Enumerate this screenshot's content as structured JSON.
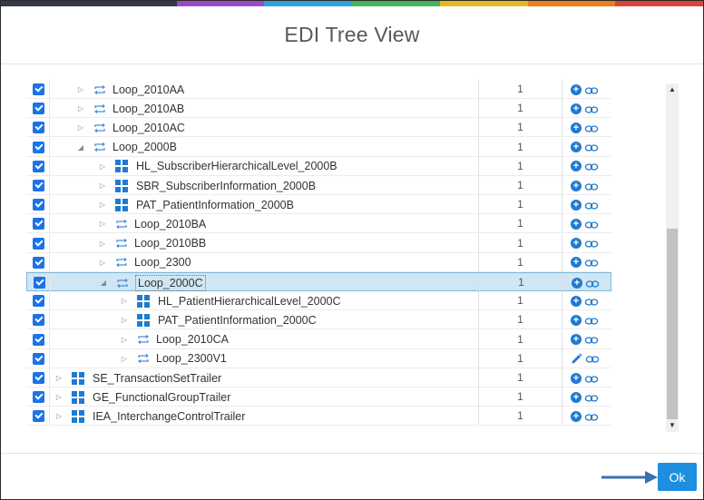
{
  "dialog": {
    "title": "EDI Tree View",
    "ok_label": "Ok",
    "stripe_colors": [
      "#33384d",
      "#33384d",
      "#9a4bc4",
      "#2ea2e5",
      "#43b55c",
      "#e8b71c",
      "#f07c1c",
      "#d9453a"
    ]
  },
  "rows": [
    {
      "name": "Loop_2010AA",
      "type": "loop",
      "level": 1,
      "expand": "collapsed",
      "count": "1",
      "action": "plus"
    },
    {
      "name": "Loop_2010AB",
      "type": "loop",
      "level": 1,
      "expand": "collapsed",
      "count": "1",
      "action": "plus"
    },
    {
      "name": "Loop_2010AC",
      "type": "loop",
      "level": 1,
      "expand": "collapsed",
      "count": "1",
      "action": "plus"
    },
    {
      "name": "Loop_2000B",
      "type": "loop",
      "level": 1,
      "expand": "expanded",
      "count": "1",
      "action": "plus"
    },
    {
      "name": "HL_SubscriberHierarchicalLevel_2000B",
      "type": "segment",
      "level": 2,
      "expand": "collapsed",
      "count": "1",
      "action": "plus"
    },
    {
      "name": "SBR_SubscriberInformation_2000B",
      "type": "segment",
      "level": 2,
      "expand": "collapsed",
      "count": "1",
      "action": "plus"
    },
    {
      "name": "PAT_PatientInformation_2000B",
      "type": "segment",
      "level": 2,
      "expand": "collapsed",
      "count": "1",
      "action": "plus"
    },
    {
      "name": "Loop_2010BA",
      "type": "loop",
      "level": 2,
      "expand": "collapsed",
      "count": "1",
      "action": "plus"
    },
    {
      "name": "Loop_2010BB",
      "type": "loop",
      "level": 2,
      "expand": "collapsed",
      "count": "1",
      "action": "plus"
    },
    {
      "name": "Loop_2300",
      "type": "loop",
      "level": 2,
      "expand": "collapsed",
      "count": "1",
      "action": "plus"
    },
    {
      "name": "Loop_2000C",
      "type": "loop",
      "level": 2,
      "expand": "expanded",
      "count": "1",
      "action": "plus",
      "selected": true
    },
    {
      "name": "HL_PatientHierarchicalLevel_2000C",
      "type": "segment",
      "level": 3,
      "expand": "collapsed",
      "count": "1",
      "action": "plus"
    },
    {
      "name": "PAT_PatientInformation_2000C",
      "type": "segment",
      "level": 3,
      "expand": "collapsed",
      "count": "1",
      "action": "plus"
    },
    {
      "name": "Loop_2010CA",
      "type": "loop",
      "level": 3,
      "expand": "collapsed",
      "count": "1",
      "action": "plus"
    },
    {
      "name": "Loop_2300V1",
      "type": "loop",
      "level": 3,
      "expand": "collapsed",
      "count": "1",
      "action": "pencil"
    },
    {
      "name": "SE_TransactionSetTrailer",
      "type": "segment",
      "level": 0,
      "expand": "collapsed",
      "count": "1",
      "action": "plus"
    },
    {
      "name": "GE_FunctionalGroupTrailer",
      "type": "segment",
      "level": 0,
      "expand": "collapsed",
      "count": "1",
      "action": "plus"
    },
    {
      "name": "IEA_InterchangeControlTrailer",
      "type": "segment",
      "level": 0,
      "expand": "collapsed",
      "count": "1",
      "action": "plus"
    }
  ]
}
